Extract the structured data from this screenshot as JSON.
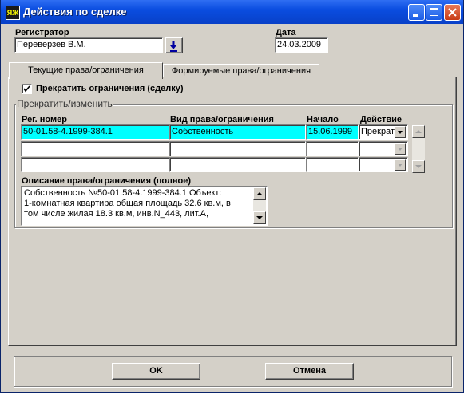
{
  "window": {
    "title": "Действия по сделке",
    "app_icon_text": "ЯЖ",
    "controls": [
      "minimize-icon",
      "maximize-icon",
      "close-icon"
    ]
  },
  "header": {
    "registrar_label": "Регистратор",
    "registrar_value": "Переверзев В.М.",
    "date_label": "Дата",
    "date_value": "24.03.2009"
  },
  "tabs": [
    {
      "label": "Текущие права/ограничения",
      "active": true
    },
    {
      "label": "Формируемые права/ограничения",
      "active": false
    }
  ],
  "panel": {
    "checkbox_label": "Прекратить ограничения (сделку)",
    "checkbox_checked": true,
    "group_title": "Прекратить/изменить",
    "columns": [
      "Рег. номер",
      "Вид права/ограничения",
      "Начало",
      "Действие"
    ],
    "rows": [
      {
        "reg_number": "50-01.58-4.1999-384.1",
        "right_type": "Собственность",
        "start": "15.06.1999",
        "action": "Прекрат",
        "selected": true
      },
      {
        "reg_number": "",
        "right_type": "",
        "start": "",
        "action": "",
        "selected": false
      },
      {
        "reg_number": "",
        "right_type": "",
        "start": "",
        "action": "",
        "selected": false
      }
    ],
    "description_label": "Описание права/ограничения (полное)",
    "description_lines": [
      "Собственность №50-01.58-4.1999-384.1 Объект:",
      "1-комнатная квартира   общая площадь 32.6 кв.м, в",
      "том числе жилая 18.3 кв.м, инв.N_443, лит.А,"
    ]
  },
  "footer": {
    "ok_label": "OK",
    "cancel_label": "Отмена"
  },
  "colors": {
    "titlebar": "#0a4de0",
    "face": "#d4d0c8",
    "selection": "#00ffff"
  }
}
